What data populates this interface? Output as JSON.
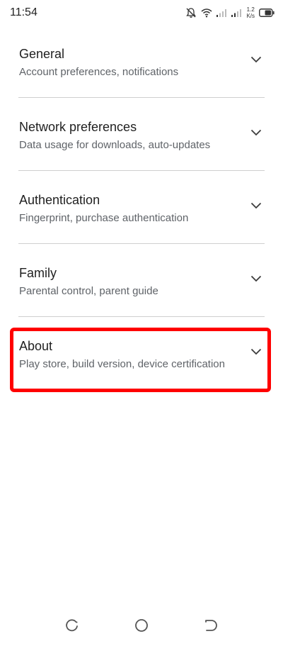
{
  "status_bar": {
    "time": "11:54",
    "speed_value": "1.2",
    "speed_unit": "K/s",
    "icons": [
      "bell-off-icon",
      "wifi-icon",
      "signal-icon",
      "signal-icon",
      "battery-icon"
    ]
  },
  "settings": {
    "items": [
      {
        "title": "General",
        "subtitle": "Account preferences, notifications"
      },
      {
        "title": "Network preferences",
        "subtitle": "Data usage for downloads, auto-updates"
      },
      {
        "title": "Authentication",
        "subtitle": "Fingerprint, purchase authentication"
      },
      {
        "title": "Family",
        "subtitle": "Parental control, parent guide"
      },
      {
        "title": "About",
        "subtitle": "Play store, build version, device certification"
      }
    ]
  },
  "annotation": {
    "highlight_color": "#ff0000",
    "highlighted_item": "About"
  },
  "nav_bar": {
    "icons": [
      "recents-icon",
      "home-icon",
      "back-icon"
    ]
  }
}
